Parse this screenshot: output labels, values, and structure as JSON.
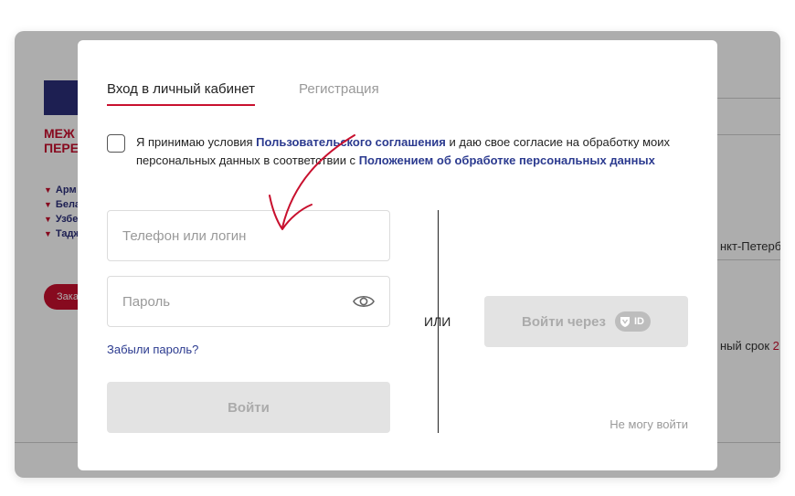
{
  "background": {
    "brand_line1": "МЕЖ",
    "brand_line2": "ПЕРЕ",
    "countries": [
      "Арм",
      "Бела",
      "Узбе",
      "Тадж"
    ],
    "cta": "Зака",
    "right_text_1": "нкт-Петербу",
    "right_text_2": "ный срок ",
    "right_text_2_red": "2"
  },
  "tabs": {
    "login": "Вход в личный кабинет",
    "register": "Регистрация"
  },
  "consent": {
    "prefix": "Я принимаю условия ",
    "link1": "Пользовательского соглашения",
    "middle": " и даю свое согласие на обработку моих персональных данных в соответствии с ",
    "link2": "Положением об обработке персональных данных"
  },
  "form": {
    "login_placeholder": "Телефон или логин",
    "password_placeholder": "Пароль",
    "forgot_link": "Забыли пароль?",
    "submit_label": "Войти"
  },
  "alt_login": {
    "or_label": "ИЛИ",
    "id_button_label": "Войти через",
    "id_badge": "ID",
    "cant_login": "Не могу войти"
  },
  "colors": {
    "accent": "#c8102e",
    "link": "#2b3a8f",
    "disabled_bg": "#e3e3e3"
  }
}
